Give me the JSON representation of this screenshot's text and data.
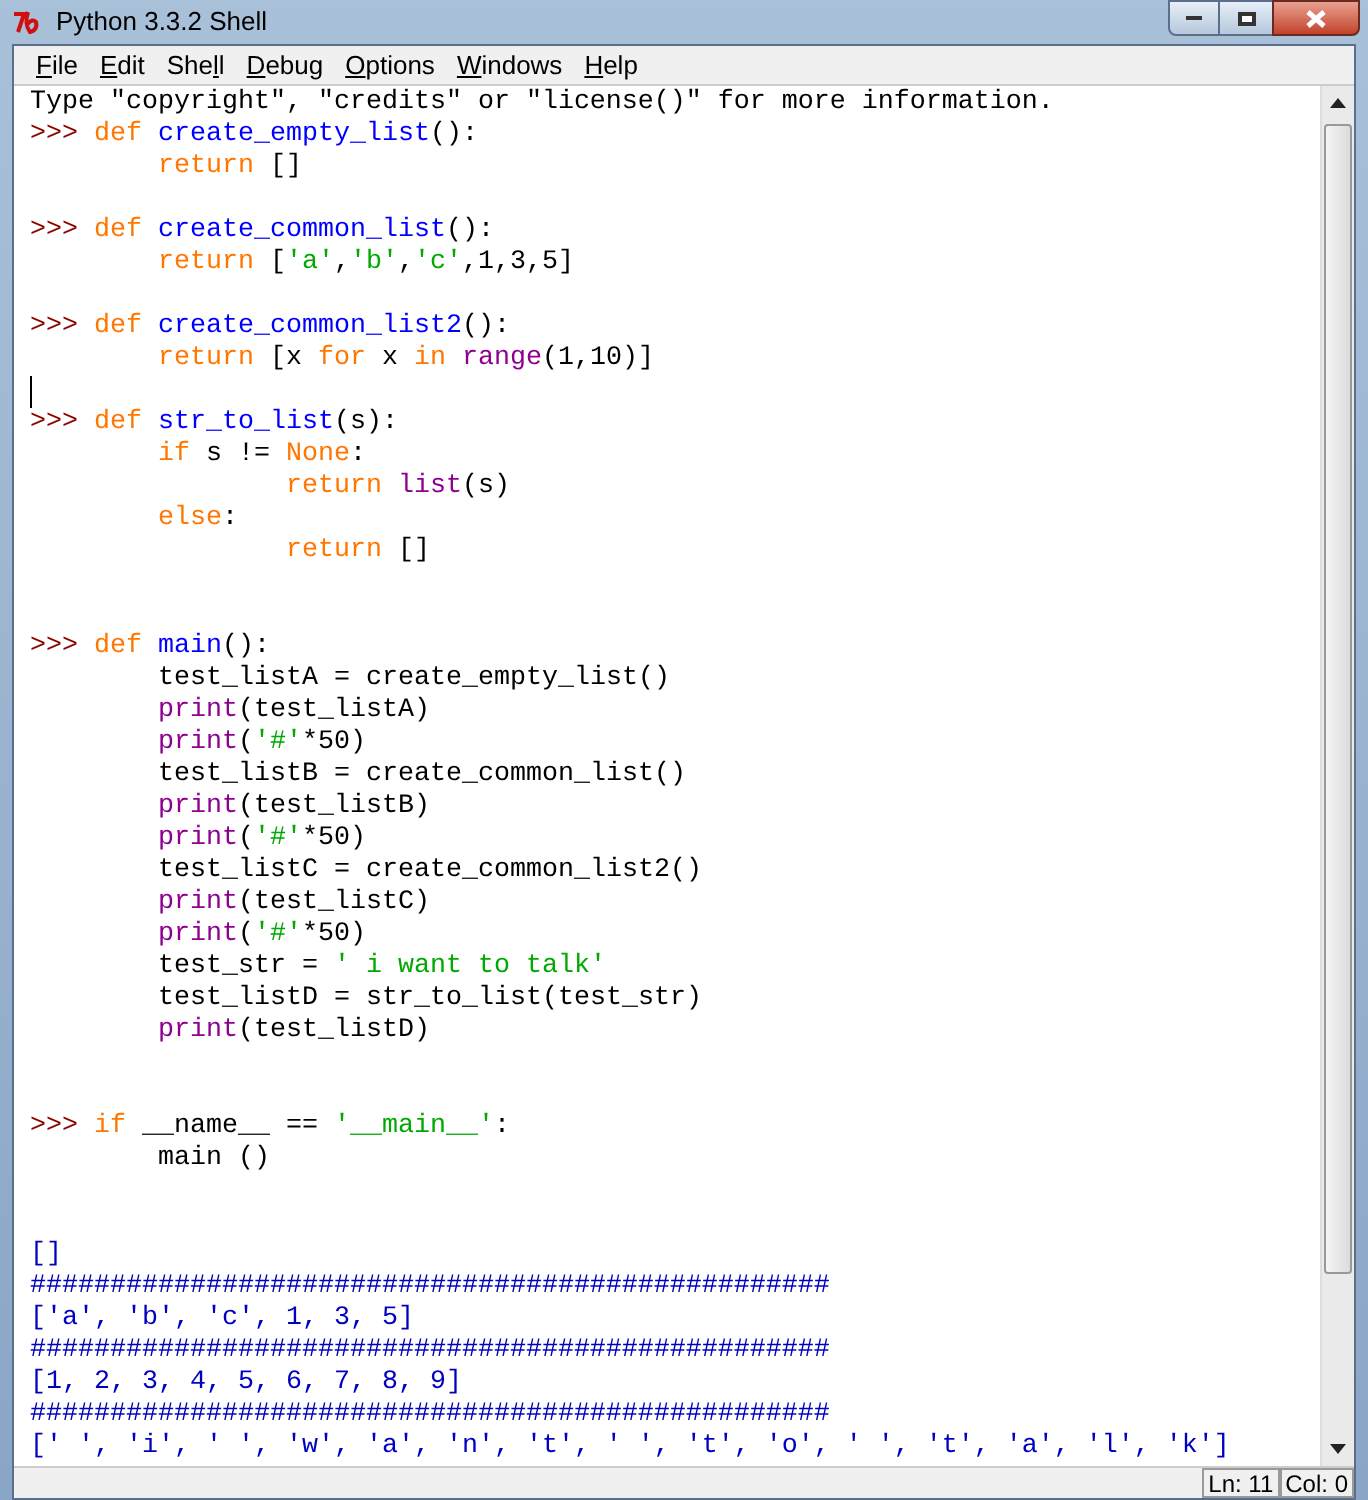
{
  "window": {
    "title": "Python 3.3.2 Shell"
  },
  "menu": [
    {
      "parts": [
        {
          "text": "F",
          "underlined": true
        },
        {
          "text": "ile",
          "underlined": false
        }
      ]
    },
    {
      "parts": [
        {
          "text": "E",
          "underlined": true
        },
        {
          "text": "dit",
          "underlined": false
        }
      ]
    },
    {
      "parts": [
        {
          "text": "She",
          "underlined": false
        },
        {
          "text": "l",
          "underlined": true
        },
        {
          "text": "l",
          "underlined": false
        }
      ]
    },
    {
      "parts": [
        {
          "text": "D",
          "underlined": true
        },
        {
          "text": "ebug",
          "underlined": false
        }
      ]
    },
    {
      "parts": [
        {
          "text": "O",
          "underlined": true
        },
        {
          "text": "ptions",
          "underlined": false
        }
      ]
    },
    {
      "parts": [
        {
          "text": "W",
          "underlined": true
        },
        {
          "text": "indows",
          "underlined": false
        }
      ]
    },
    {
      "parts": [
        {
          "text": "H",
          "underlined": true
        },
        {
          "text": "elp",
          "underlined": false
        }
      ]
    }
  ],
  "lines": [
    {
      "kind": "code",
      "tokens": [
        {
          "kind": "plain",
          "text": "Type \"copyright\", \"credits\" or \"license()\" for more information."
        }
      ]
    },
    {
      "kind": "code",
      "prompt": ">>>",
      "tokens": [
        {
          "kind": "keyword",
          "text": "def"
        },
        {
          "kind": "defname",
          "text": " create_empty_list"
        },
        {
          "kind": "plain",
          "text": "():"
        }
      ]
    },
    {
      "kind": "body",
      "tokens": [
        {
          "kind": "keyword",
          "text": "return"
        },
        {
          "kind": "plain",
          "text": " []"
        }
      ]
    },
    {
      "kind": "blank"
    },
    {
      "kind": "code",
      "prompt": ">>>",
      "tokens": [
        {
          "kind": "keyword",
          "text": "def"
        },
        {
          "kind": "defname",
          "text": " create_common_list"
        },
        {
          "kind": "plain",
          "text": "():"
        }
      ]
    },
    {
      "kind": "body",
      "tokens": [
        {
          "kind": "keyword",
          "text": "return"
        },
        {
          "kind": "plain",
          "text": " ["
        },
        {
          "kind": "string",
          "text": "'a'"
        },
        {
          "kind": "plain",
          "text": ","
        },
        {
          "kind": "string",
          "text": "'b'"
        },
        {
          "kind": "plain",
          "text": ","
        },
        {
          "kind": "string",
          "text": "'c'"
        },
        {
          "kind": "plain",
          "text": ",1,3,5]"
        }
      ]
    },
    {
      "kind": "blank"
    },
    {
      "kind": "code",
      "prompt": ">>>",
      "tokens": [
        {
          "kind": "keyword",
          "text": "def"
        },
        {
          "kind": "defname",
          "text": " create_common_list2"
        },
        {
          "kind": "plain",
          "text": "():"
        }
      ]
    },
    {
      "kind": "body",
      "tokens": [
        {
          "kind": "keyword",
          "text": "return"
        },
        {
          "kind": "plain",
          "text": " [x "
        },
        {
          "kind": "keyword",
          "text": "for"
        },
        {
          "kind": "plain",
          "text": " x "
        },
        {
          "kind": "keyword",
          "text": "in"
        },
        {
          "kind": "builtin",
          "text": " range"
        },
        {
          "kind": "plain",
          "text": "(1,10)]"
        }
      ]
    },
    {
      "kind": "blank",
      "cursor": true
    },
    {
      "kind": "code",
      "prompt": ">>>",
      "tokens": [
        {
          "kind": "keyword",
          "text": "def"
        },
        {
          "kind": "defname",
          "text": " str_to_list"
        },
        {
          "kind": "plain",
          "text": "(s):"
        }
      ]
    },
    {
      "kind": "body",
      "tokens": [
        {
          "kind": "keyword",
          "text": "if"
        },
        {
          "kind": "plain",
          "text": " s != "
        },
        {
          "kind": "keyword",
          "text": "None"
        },
        {
          "kind": "plain",
          "text": ":"
        }
      ]
    },
    {
      "kind": "inner",
      "tokens": [
        {
          "kind": "keyword",
          "text": "return"
        },
        {
          "kind": "builtin",
          "text": " list"
        },
        {
          "kind": "plain",
          "text": "(s)"
        }
      ]
    },
    {
      "kind": "body",
      "tokens": [
        {
          "kind": "keyword",
          "text": "else"
        },
        {
          "kind": "plain",
          "text": ":"
        }
      ]
    },
    {
      "kind": "inner",
      "tokens": [
        {
          "kind": "keyword",
          "text": "return"
        },
        {
          "kind": "plain",
          "text": " []"
        }
      ]
    },
    {
      "kind": "blank"
    },
    {
      "kind": "blank"
    },
    {
      "kind": "code",
      "prompt": ">>>",
      "tokens": [
        {
          "kind": "keyword",
          "text": "def"
        },
        {
          "kind": "defname",
          "text": " main"
        },
        {
          "kind": "plain",
          "text": "():"
        }
      ]
    },
    {
      "kind": "body",
      "tokens": [
        {
          "kind": "plain",
          "text": "test_listA = create_empty_list()"
        }
      ]
    },
    {
      "kind": "body",
      "tokens": [
        {
          "kind": "builtin",
          "text": "print"
        },
        {
          "kind": "plain",
          "text": "(test_listA)"
        }
      ]
    },
    {
      "kind": "body",
      "tokens": [
        {
          "kind": "builtin",
          "text": "print"
        },
        {
          "kind": "plain",
          "text": "("
        },
        {
          "kind": "string",
          "text": "'#'"
        },
        {
          "kind": "plain",
          "text": "*50)"
        }
      ]
    },
    {
      "kind": "body",
      "tokens": [
        {
          "kind": "plain",
          "text": "test_listB = create_common_list()"
        }
      ]
    },
    {
      "kind": "body",
      "tokens": [
        {
          "kind": "builtin",
          "text": "print"
        },
        {
          "kind": "plain",
          "text": "(test_listB)"
        }
      ]
    },
    {
      "kind": "body",
      "tokens": [
        {
          "kind": "builtin",
          "text": "print"
        },
        {
          "kind": "plain",
          "text": "("
        },
        {
          "kind": "string",
          "text": "'#'"
        },
        {
          "kind": "plain",
          "text": "*50)"
        }
      ]
    },
    {
      "kind": "body",
      "tokens": [
        {
          "kind": "plain",
          "text": "test_listC = create_common_list2()"
        }
      ]
    },
    {
      "kind": "body",
      "tokens": [
        {
          "kind": "builtin",
          "text": "print"
        },
        {
          "kind": "plain",
          "text": "(test_listC)"
        }
      ]
    },
    {
      "kind": "body",
      "tokens": [
        {
          "kind": "builtin",
          "text": "print"
        },
        {
          "kind": "plain",
          "text": "("
        },
        {
          "kind": "string",
          "text": "'#'"
        },
        {
          "kind": "plain",
          "text": "*50)"
        }
      ]
    },
    {
      "kind": "body",
      "tokens": [
        {
          "kind": "plain",
          "text": "test_str = "
        },
        {
          "kind": "string",
          "text": "' i want to talk'"
        }
      ]
    },
    {
      "kind": "body",
      "tokens": [
        {
          "kind": "plain",
          "text": "test_listD = str_to_list(test_str)"
        }
      ]
    },
    {
      "kind": "body",
      "tokens": [
        {
          "kind": "builtin",
          "text": "print"
        },
        {
          "kind": "plain",
          "text": "(test_listD)"
        }
      ]
    },
    {
      "kind": "blank"
    },
    {
      "kind": "blank"
    },
    {
      "kind": "code",
      "prompt": ">>>",
      "tokens": [
        {
          "kind": "keyword",
          "text": "if"
        },
        {
          "kind": "plain",
          "text": " __name__ == "
        },
        {
          "kind": "string",
          "text": "'__main__'"
        },
        {
          "kind": "plain",
          "text": ":"
        }
      ]
    },
    {
      "kind": "body",
      "tokens": [
        {
          "kind": "plain",
          "text": "main ()"
        }
      ]
    },
    {
      "kind": "blank"
    },
    {
      "kind": "blank"
    },
    {
      "kind": "output",
      "tokens": [
        {
          "kind": "stdout",
          "text": "[]"
        }
      ]
    },
    {
      "kind": "output",
      "tokens": [
        {
          "kind": "stdout",
          "text": "##################################################"
        }
      ]
    },
    {
      "kind": "output",
      "tokens": [
        {
          "kind": "stdout",
          "text": "['a', 'b', 'c', 1, 3, 5]"
        }
      ]
    },
    {
      "kind": "output",
      "tokens": [
        {
          "kind": "stdout",
          "text": "##################################################"
        }
      ]
    },
    {
      "kind": "output",
      "tokens": [
        {
          "kind": "stdout",
          "text": "[1, 2, 3, 4, 5, 6, 7, 8, 9]"
        }
      ]
    },
    {
      "kind": "output",
      "tokens": [
        {
          "kind": "stdout",
          "text": "##################################################"
        }
      ]
    },
    {
      "kind": "output",
      "tokens": [
        {
          "kind": "stdout",
          "text": "[' ', 'i', ' ', 'w', 'a', 'n', 't', ' ', 't', 'o', ' ', 't', 'a', 'l', 'k']"
        }
      ]
    }
  ],
  "status_bar": {
    "line": "Ln: 11",
    "column": "Col: 0"
  }
}
